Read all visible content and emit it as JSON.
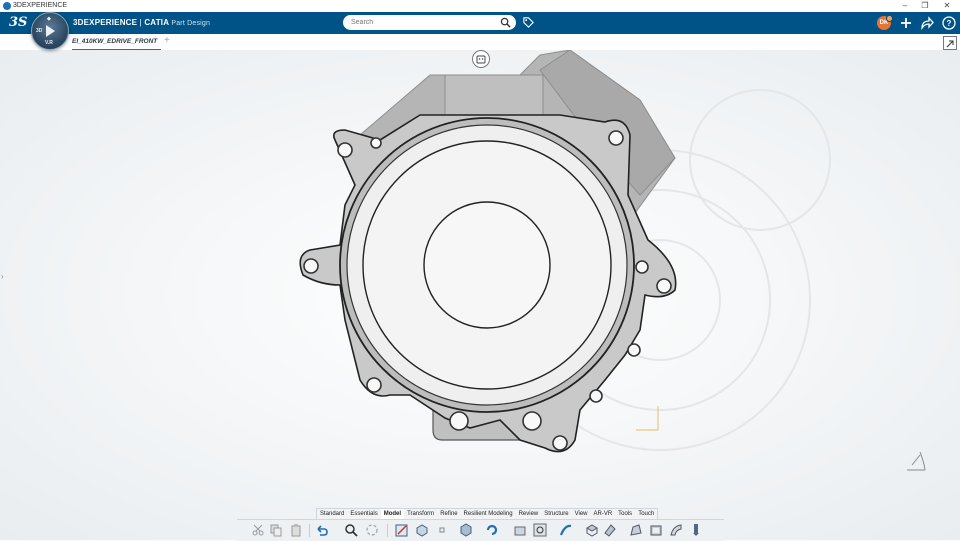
{
  "window": {
    "title": "3DEXPERIENCE"
  },
  "topbar": {
    "brand_bold": "3DEXPERIENCE",
    "brand_sep": " | ",
    "brand_app": "CATIA",
    "brand_role": " Part Design",
    "search_placeholder": "Search",
    "avatar_initials": "DK",
    "compass_north": "V.R",
    "compass_left": "3D"
  },
  "document": {
    "tab_label": "EI_410KW_EDRIVE_FRONT",
    "add_tab": "+"
  },
  "toolbar": {
    "tabs": [
      "Standard",
      "Essentials",
      "Model",
      "Transform",
      "Refine",
      "Resilient Modeling",
      "Review",
      "Structure",
      "View",
      "AR-VR",
      "Tools",
      "Touch"
    ],
    "active_tab": "Model"
  },
  "colors": {
    "topbar": "#005386",
    "accent": "#1f6fb6",
    "part_gray": "#b9b9b9",
    "part_light": "#f3f3f3"
  },
  "icons": [
    "dassault-logo-icon",
    "compass-icon",
    "search-icon",
    "tag-icon",
    "add-icon",
    "share-icon",
    "help-icon",
    "maximize-icon",
    "robot-icon",
    "axis-triad-icon"
  ]
}
